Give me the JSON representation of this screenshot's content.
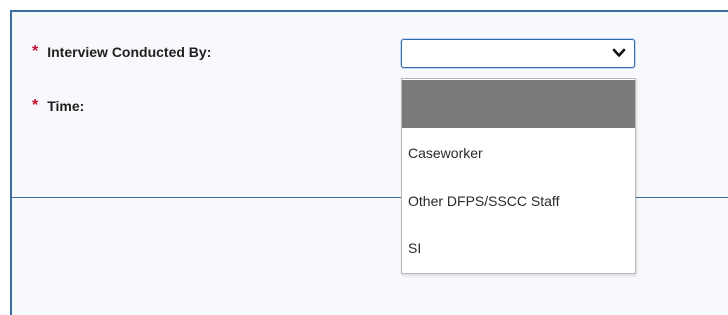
{
  "form": {
    "interview_conducted_by": {
      "required_marker": "*",
      "label": "Interview Conducted By:",
      "selected_value": "",
      "options": [
        "",
        "Caseworker",
        "Other DFPS/SSCC Staff",
        "SI"
      ],
      "highlighted_option_index": 0
    },
    "time": {
      "required_marker": "*",
      "label": "Time:"
    }
  },
  "icons": {
    "dropdown_toggle": "chevron-down-icon"
  },
  "colors": {
    "panel_border": "#3a6ea5",
    "required_marker": "#c8102e",
    "select_focus_border": "#2f6cb3",
    "highlighted_option": "#7a7a7a"
  }
}
